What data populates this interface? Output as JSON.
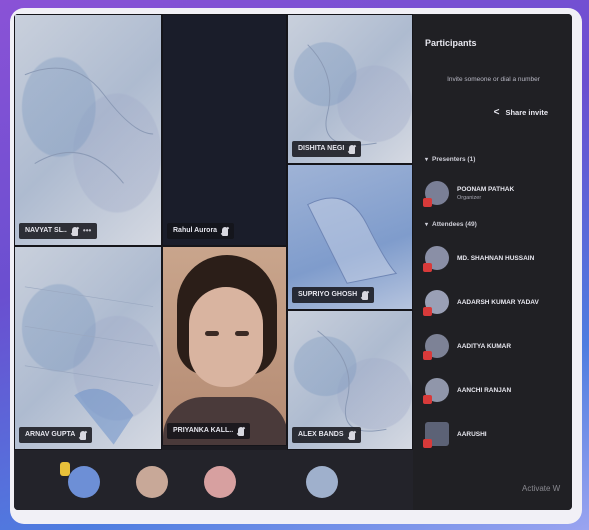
{
  "tiles": [
    {
      "id": "t1",
      "name": "NAVYAT SL..",
      "style": "map"
    },
    {
      "id": "t2",
      "name": "Rahul Aurora",
      "style": "dark"
    },
    {
      "id": "t3",
      "name": "DISHITA NEGI",
      "style": "map"
    },
    {
      "id": "t4",
      "name": "SUPRIYO GHOSH",
      "style": "blue"
    },
    {
      "id": "t5",
      "name": "ARNAV GUPTA",
      "style": "map"
    },
    {
      "id": "t6",
      "name": "PRIYANKA KALL..",
      "style": "person"
    },
    {
      "id": "t7",
      "name": "ALEX BANDS",
      "style": "map"
    }
  ],
  "panel": {
    "title": "Participants",
    "invite_placeholder": "Invite someone or dial a number",
    "share_label": "Share invite",
    "presenters_label": "Presenters (1)",
    "attendees_label": "Attendees (49)",
    "presenters": [
      {
        "name": "POONAM PATHAK",
        "role": "Organizer"
      }
    ],
    "attendees": [
      {
        "name": "MD. SHAHNAN HUSSAIN"
      },
      {
        "name": "AADARSH KUMAR YADAV"
      },
      {
        "name": "AADITYA KUMAR"
      },
      {
        "name": "AANCHI RANJAN"
      },
      {
        "name": "AARUSHI"
      }
    ]
  },
  "watermark": "Activate W",
  "colors": {
    "panel_bg": "#202024",
    "accent_red": "#d83a3a"
  }
}
